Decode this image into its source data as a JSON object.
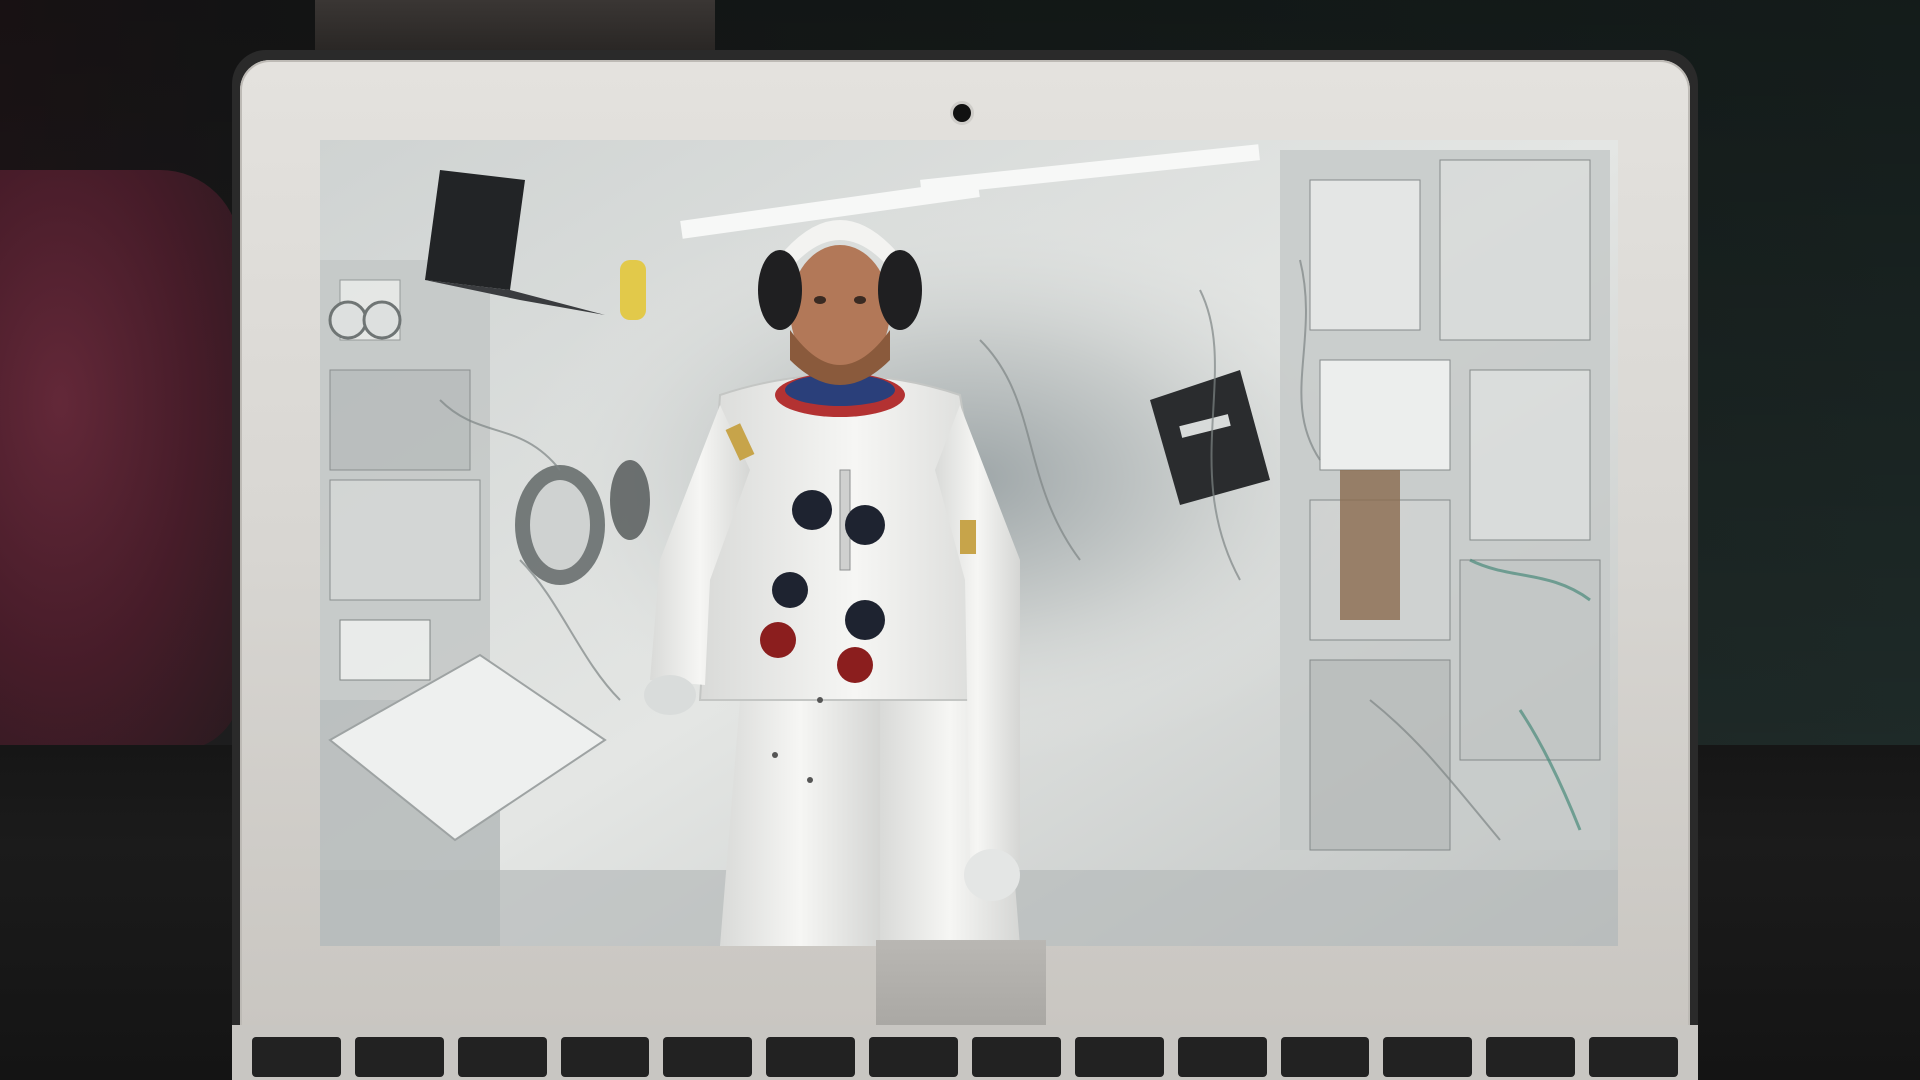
{
  "scene": {
    "description_colors": {
      "bezel": "#d8d6d2",
      "screen_bg": "#d9dcda",
      "cushion": "#6b2a3c",
      "suit": "#f2f2f0",
      "button_dark": "#1e2330",
      "button_red": "#8b1e1e"
    }
  }
}
